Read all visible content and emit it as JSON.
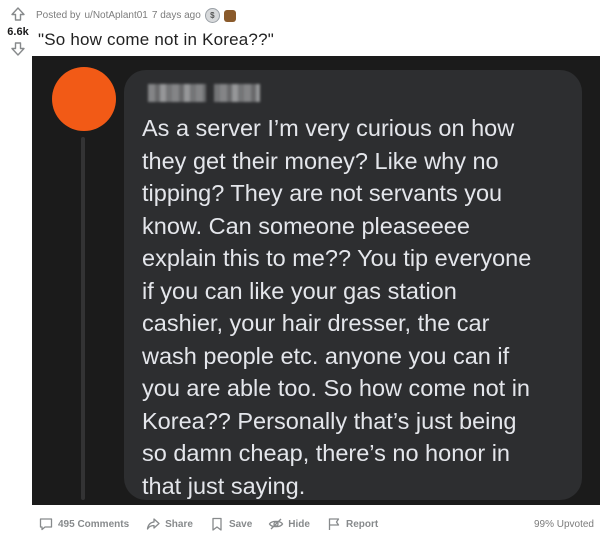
{
  "post": {
    "vote_count": "6.6k",
    "posted_by_prefix": "Posted by",
    "username": "u/NotAplant01",
    "age": "7 days ago",
    "title": "\"So how come not in Korea??\"",
    "awards": [
      "silver-award-icon",
      "bear-award-icon"
    ]
  },
  "image": {
    "comment_text": "As a server I’m very curious on how\nthey get their money? Like why no\ntipping? They are not servants you\nknow. Can someone pleaseeee\nexplain this to me?? You tip everyone\nif you can like your gas station\ncashier, your hair dresser, the car\nwash people etc. anyone you can if\nyou are able too. So how come not in\nKorea?? Personally that’s just being\nso damn cheap, there’s no honor in\nthat just saying.",
    "avatar_color": "#f25a16",
    "bubble_color": "#2d2e30",
    "background_color": "#1b1b1b"
  },
  "actions": {
    "comments_label": "495 Comments",
    "share_label": "Share",
    "save_label": "Save",
    "hide_label": "Hide",
    "report_label": "Report",
    "upvoted_label": "99% Upvoted"
  }
}
